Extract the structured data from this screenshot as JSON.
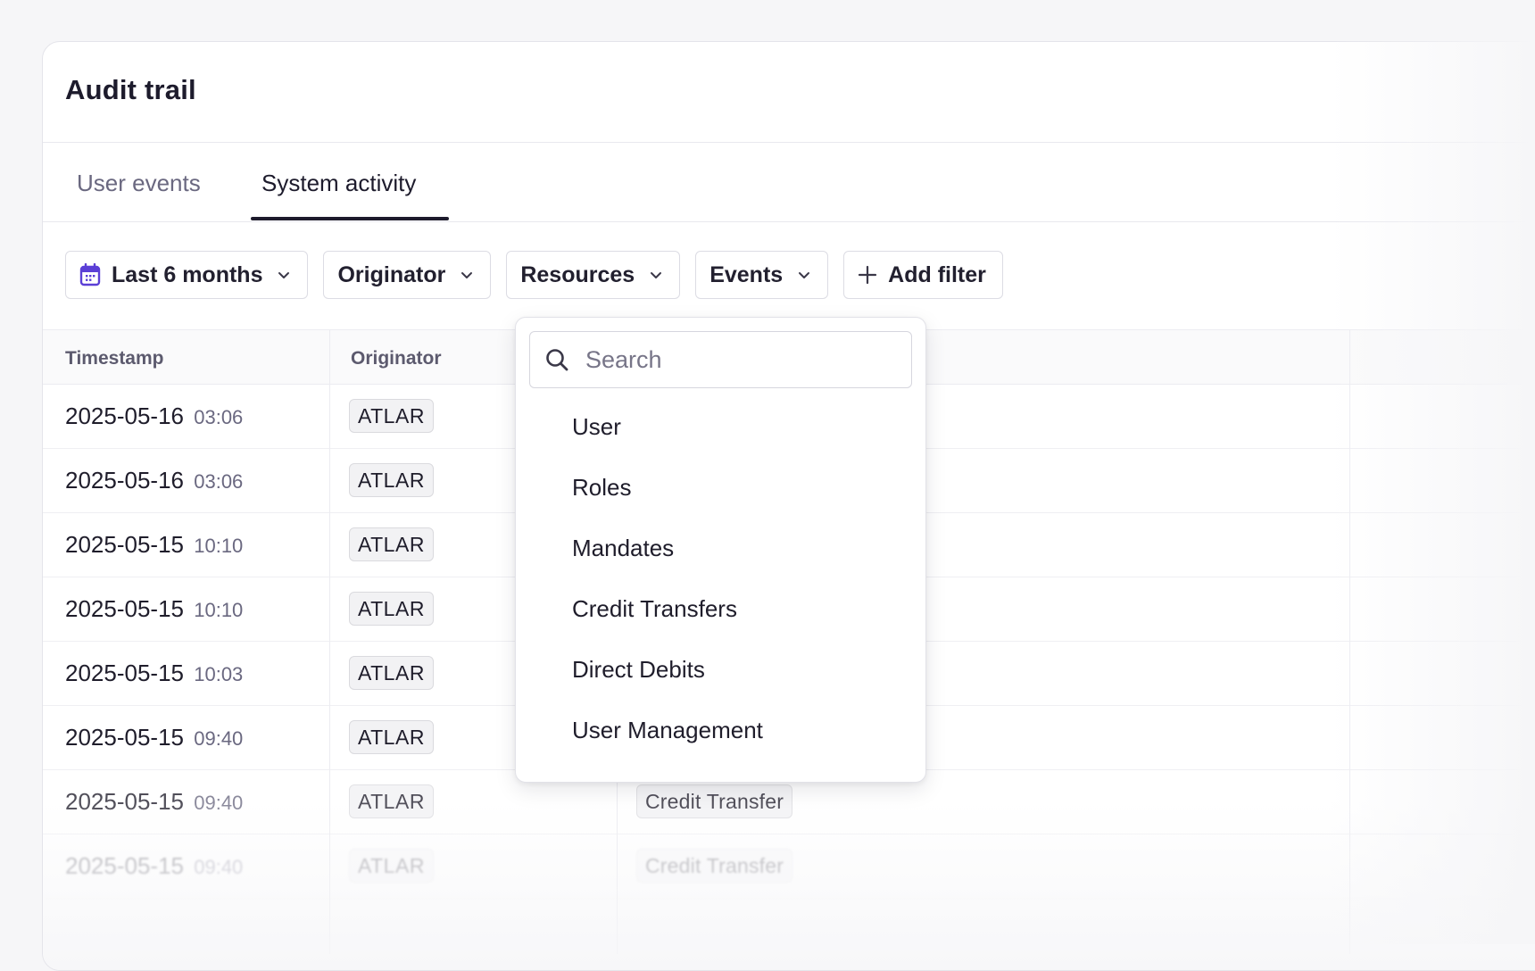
{
  "card": {
    "title": "Audit trail"
  },
  "tabs": [
    {
      "label": "User events",
      "active": false
    },
    {
      "label": "System activity",
      "active": true
    }
  ],
  "filters": {
    "date_range": "Last 6 months",
    "originator": "Originator",
    "resources": "Resources",
    "events": "Events",
    "add_filter": "Add filter"
  },
  "table": {
    "headers": {
      "timestamp": "Timestamp",
      "originator": "Originator"
    },
    "rows": [
      {
        "date": "2025-05-16",
        "time": "03:06",
        "originator": "ATLAR",
        "resource": ""
      },
      {
        "date": "2025-05-16",
        "time": "03:06",
        "originator": "ATLAR",
        "resource": ""
      },
      {
        "date": "2025-05-15",
        "time": "10:10",
        "originator": "ATLAR",
        "resource": ""
      },
      {
        "date": "2025-05-15",
        "time": "10:10",
        "originator": "ATLAR",
        "resource": ""
      },
      {
        "date": "2025-05-15",
        "time": "10:03",
        "originator": "ATLAR",
        "resource": ""
      },
      {
        "date": "2025-05-15",
        "time": "09:40",
        "originator": "ATLAR",
        "resource": ""
      },
      {
        "date": "2025-05-15",
        "time": "09:40",
        "originator": "ATLAR",
        "resource": "Credit Transfer"
      },
      {
        "date": "2025-05-15",
        "time": "09:40",
        "originator": "ATLAR",
        "resource": "Credit Transfer"
      }
    ]
  },
  "resources_dropdown": {
    "search_placeholder": "Search",
    "options": [
      "User",
      "Roles",
      "Mandates",
      "Credit Transfers",
      "Direct Debits",
      "User Management"
    ]
  },
  "icons": {
    "calendar": "calendar-icon",
    "chevron": "chevron-down-icon",
    "plus": "plus-icon",
    "search": "search-icon"
  },
  "colors": {
    "accent": "#5b3fd6",
    "background": "#f6f6f8",
    "text": "#1f1d2b",
    "muted": "#6a6880"
  }
}
